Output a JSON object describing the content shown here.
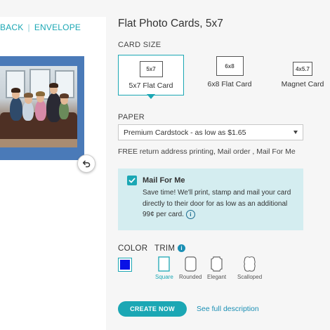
{
  "preview": {
    "tabs": [
      "BACK",
      "ENVELOPE"
    ],
    "separator": "|",
    "card_color": "#4a7ab8"
  },
  "product": {
    "title": "Flat Photo Cards, 5x7"
  },
  "card_size": {
    "label": "CARD SIZE",
    "options": [
      {
        "thumb": "5x7",
        "label": "5x7 Flat Card",
        "selected": true
      },
      {
        "thumb": "6x8",
        "label": "6x8 Flat Card",
        "selected": false
      },
      {
        "thumb": "4x5.7",
        "label": "Magnet Card",
        "selected": false
      }
    ]
  },
  "paper": {
    "label": "PAPER",
    "selected": "Premium Cardstock - as low as $1.65",
    "note": "FREE return address printing, Mail order , Mail For Me"
  },
  "mail_for_me": {
    "checked": true,
    "title": "Mail For Me",
    "body": "Save time! We'll print, stamp and mail your card directly to their door for as low as an additional 99¢ per card.",
    "info_icon": "i"
  },
  "color": {
    "label": "COLOR",
    "selected_hex": "#0a12e6"
  },
  "trim": {
    "label": "TRIM",
    "info_icon": "i",
    "options": [
      {
        "label": "Square",
        "selected": true
      },
      {
        "label": "Rounded",
        "selected": false
      },
      {
        "label": "Elegant",
        "selected": false
      },
      {
        "label": "Scalloped",
        "selected": false
      }
    ]
  },
  "actions": {
    "create_label": "CREATE NOW",
    "description_link": "See full description"
  },
  "colors": {
    "accent": "#1ba7b4",
    "link": "#1a8fb4",
    "mail_bg": "#d4edf0"
  }
}
